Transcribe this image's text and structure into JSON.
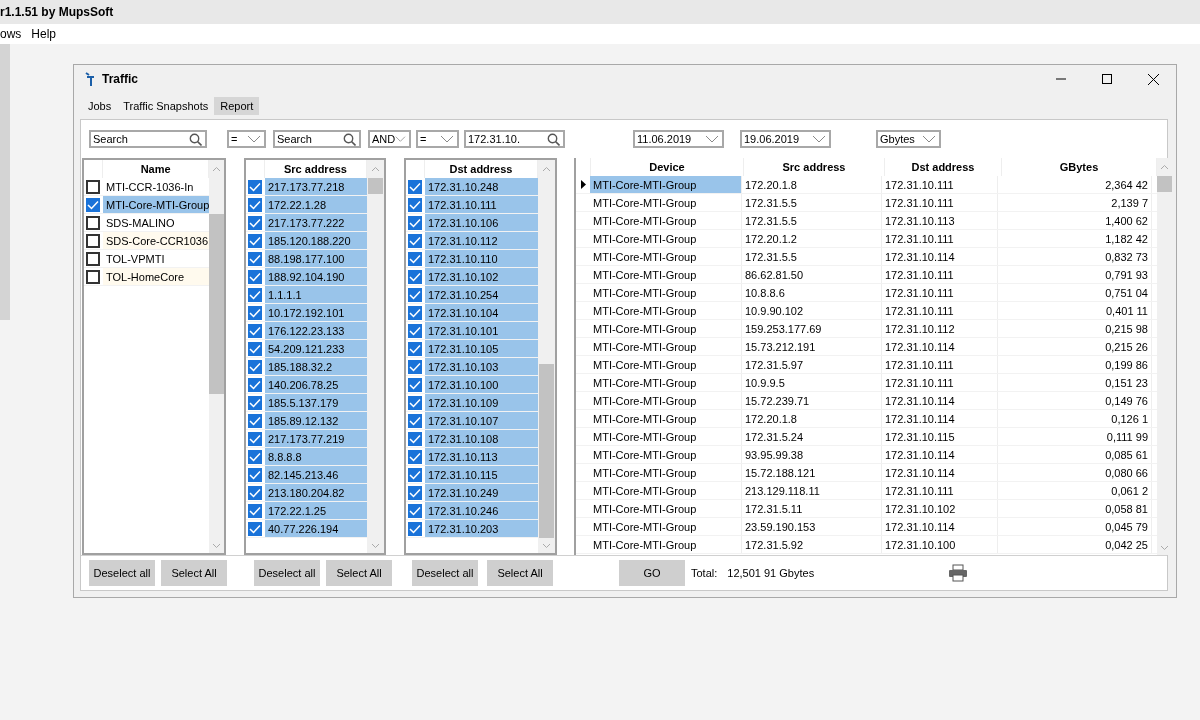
{
  "app_title": "r1.1.51  by MupsSoft",
  "menu": [
    "ows",
    "Help"
  ],
  "window": {
    "title": "Traffic"
  },
  "tabs": [
    {
      "label": "Jobs",
      "selected": false
    },
    {
      "label": "Traffic Snapshots",
      "selected": false
    },
    {
      "label": "Report",
      "selected": true
    }
  ],
  "filters": {
    "name_search": {
      "placeholder": "Search"
    },
    "src_operator": "=",
    "src_search": {
      "placeholder": "Search"
    },
    "logic": "AND",
    "dst_operator": "=",
    "dst_search": {
      "value": "172.31.10."
    },
    "date_from": "11.06.2019",
    "date_to": "19.06.2019",
    "unit": "Gbytes"
  },
  "name_list": {
    "header": "Name",
    "items": [
      {
        "label": "MTI-CCR-1036-In",
        "checked": false,
        "selected": false
      },
      {
        "label": "MTI-Core-MTI-Group",
        "checked": true,
        "selected": true
      },
      {
        "label": "SDS-MALINO",
        "checked": false,
        "selected": false
      },
      {
        "label": "SDS-Core-CCR1036",
        "checked": false,
        "selected": false
      },
      {
        "label": "TOL-VPMTI",
        "checked": false,
        "selected": false
      },
      {
        "label": "TOL-HomeCore",
        "checked": false,
        "selected": false
      }
    ]
  },
  "src_list": {
    "header": "Src address",
    "items": [
      {
        "label": "217.173.77.218",
        "checked": true,
        "selected": true
      },
      {
        "label": "172.22.1.28",
        "checked": true,
        "selected": true
      },
      {
        "label": "217.173.77.222",
        "checked": true,
        "selected": true
      },
      {
        "label": "185.120.188.220",
        "checked": true,
        "selected": true
      },
      {
        "label": "88.198.177.100",
        "checked": true,
        "selected": true
      },
      {
        "label": "188.92.104.190",
        "checked": true,
        "selected": true
      },
      {
        "label": "1.1.1.1",
        "checked": true,
        "selected": true
      },
      {
        "label": "10.172.192.101",
        "checked": true,
        "selected": true
      },
      {
        "label": "176.122.23.133",
        "checked": true,
        "selected": true
      },
      {
        "label": "54.209.121.233",
        "checked": true,
        "selected": true
      },
      {
        "label": "185.188.32.2",
        "checked": true,
        "selected": true
      },
      {
        "label": "140.206.78.25",
        "checked": true,
        "selected": true
      },
      {
        "label": "185.5.137.179",
        "checked": true,
        "selected": true
      },
      {
        "label": "185.89.12.132",
        "checked": true,
        "selected": true
      },
      {
        "label": "217.173.77.219",
        "checked": true,
        "selected": true
      },
      {
        "label": "8.8.8.8",
        "checked": true,
        "selected": true
      },
      {
        "label": "82.145.213.46",
        "checked": true,
        "selected": true
      },
      {
        "label": "213.180.204.82",
        "checked": true,
        "selected": true
      },
      {
        "label": "172.22.1.25",
        "checked": true,
        "selected": true
      },
      {
        "label": "40.77.226.194",
        "checked": true,
        "selected": true
      }
    ]
  },
  "dst_list": {
    "header": "Dst address",
    "items": [
      {
        "label": "172.31.10.248",
        "checked": true,
        "selected": true
      },
      {
        "label": "172.31.10.111",
        "checked": true,
        "selected": true
      },
      {
        "label": "172.31.10.106",
        "checked": true,
        "selected": true
      },
      {
        "label": "172.31.10.112",
        "checked": true,
        "selected": true
      },
      {
        "label": "172.31.10.110",
        "checked": true,
        "selected": true
      },
      {
        "label": "172.31.10.102",
        "checked": true,
        "selected": true
      },
      {
        "label": "172.31.10.254",
        "checked": true,
        "selected": true
      },
      {
        "label": "172.31.10.104",
        "checked": true,
        "selected": true
      },
      {
        "label": "172.31.10.101",
        "checked": true,
        "selected": true
      },
      {
        "label": "172.31.10.105",
        "checked": true,
        "selected": true
      },
      {
        "label": "172.31.10.103",
        "checked": true,
        "selected": true
      },
      {
        "label": "172.31.10.100",
        "checked": true,
        "selected": true
      },
      {
        "label": "172.31.10.109",
        "checked": true,
        "selected": true
      },
      {
        "label": "172.31.10.107",
        "checked": true,
        "selected": true
      },
      {
        "label": "172.31.10.108",
        "checked": true,
        "selected": true
      },
      {
        "label": "172.31.10.113",
        "checked": true,
        "selected": true
      },
      {
        "label": "172.31.10.115",
        "checked": true,
        "selected": true
      },
      {
        "label": "172.31.10.249",
        "checked": true,
        "selected": true
      },
      {
        "label": "172.31.10.246",
        "checked": true,
        "selected": true
      },
      {
        "label": "172.31.10.203",
        "checked": true,
        "selected": true
      }
    ]
  },
  "table": {
    "columns": [
      "Device",
      "Src address",
      "Dst address",
      "GBytes"
    ],
    "rows": [
      {
        "device": "MTI-Core-MTI-Group",
        "src": "172.20.1.8",
        "dst": "172.31.10.111",
        "gbytes": "2,364 42",
        "selected": true
      },
      {
        "device": "MTI-Core-MTI-Group",
        "src": "172.31.5.5",
        "dst": "172.31.10.111",
        "gbytes": "2,139 7",
        "selected": false
      },
      {
        "device": "MTI-Core-MTI-Group",
        "src": "172.31.5.5",
        "dst": "172.31.10.113",
        "gbytes": "1,400 62",
        "selected": false
      },
      {
        "device": "MTI-Core-MTI-Group",
        "src": "172.20.1.2",
        "dst": "172.31.10.111",
        "gbytes": "1,182 42",
        "selected": false
      },
      {
        "device": "MTI-Core-MTI-Group",
        "src": "172.31.5.5",
        "dst": "172.31.10.114",
        "gbytes": "0,832 73",
        "selected": false
      },
      {
        "device": "MTI-Core-MTI-Group",
        "src": "86.62.81.50",
        "dst": "172.31.10.111",
        "gbytes": "0,791 93",
        "selected": false
      },
      {
        "device": "MTI-Core-MTI-Group",
        "src": "10.8.8.6",
        "dst": "172.31.10.111",
        "gbytes": "0,751 04",
        "selected": false
      },
      {
        "device": "MTI-Core-MTI-Group",
        "src": "10.9.90.102",
        "dst": "172.31.10.111",
        "gbytes": "0,401 11",
        "selected": false
      },
      {
        "device": "MTI-Core-MTI-Group",
        "src": "159.253.177.69",
        "dst": "172.31.10.112",
        "gbytes": "0,215 98",
        "selected": false
      },
      {
        "device": "MTI-Core-MTI-Group",
        "src": "15.73.212.191",
        "dst": "172.31.10.114",
        "gbytes": "0,215 26",
        "selected": false
      },
      {
        "device": "MTI-Core-MTI-Group",
        "src": "172.31.5.97",
        "dst": "172.31.10.111",
        "gbytes": "0,199 86",
        "selected": false
      },
      {
        "device": "MTI-Core-MTI-Group",
        "src": "10.9.9.5",
        "dst": "172.31.10.111",
        "gbytes": "0,151 23",
        "selected": false
      },
      {
        "device": "MTI-Core-MTI-Group",
        "src": "15.72.239.71",
        "dst": "172.31.10.114",
        "gbytes": "0,149 76",
        "selected": false
      },
      {
        "device": "MTI-Core-MTI-Group",
        "src": "172.20.1.8",
        "dst": "172.31.10.114",
        "gbytes": "0,126 1",
        "selected": false
      },
      {
        "device": "MTI-Core-MTI-Group",
        "src": "172.31.5.24",
        "dst": "172.31.10.115",
        "gbytes": "0,111 99",
        "selected": false
      },
      {
        "device": "MTI-Core-MTI-Group",
        "src": "93.95.99.38",
        "dst": "172.31.10.114",
        "gbytes": "0,085 61",
        "selected": false
      },
      {
        "device": "MTI-Core-MTI-Group",
        "src": "15.72.188.121",
        "dst": "172.31.10.114",
        "gbytes": "0,080 66",
        "selected": false
      },
      {
        "device": "MTI-Core-MTI-Group",
        "src": "213.129.118.11",
        "dst": "172.31.10.111",
        "gbytes": "0,061 2",
        "selected": false
      },
      {
        "device": "MTI-Core-MTI-Group",
        "src": "172.31.5.11",
        "dst": "172.31.10.102",
        "gbytes": "0,058 81",
        "selected": false
      },
      {
        "device": "MTI-Core-MTI-Group",
        "src": "23.59.190.153",
        "dst": "172.31.10.114",
        "gbytes": "0,045 79",
        "selected": false
      },
      {
        "device": "MTI-Core-MTI-Group",
        "src": "172.31.5.92",
        "dst": "172.31.10.100",
        "gbytes": "0,042 25",
        "selected": false
      }
    ]
  },
  "buttons": {
    "name": [
      "Deselect all",
      "Select All"
    ],
    "src": [
      "Deselect all",
      "Select All"
    ],
    "dst": [
      "Deselect all",
      "Select All"
    ],
    "go": "GO"
  },
  "total": {
    "label": "Total:",
    "value": "12,501 91 Gbytes"
  }
}
